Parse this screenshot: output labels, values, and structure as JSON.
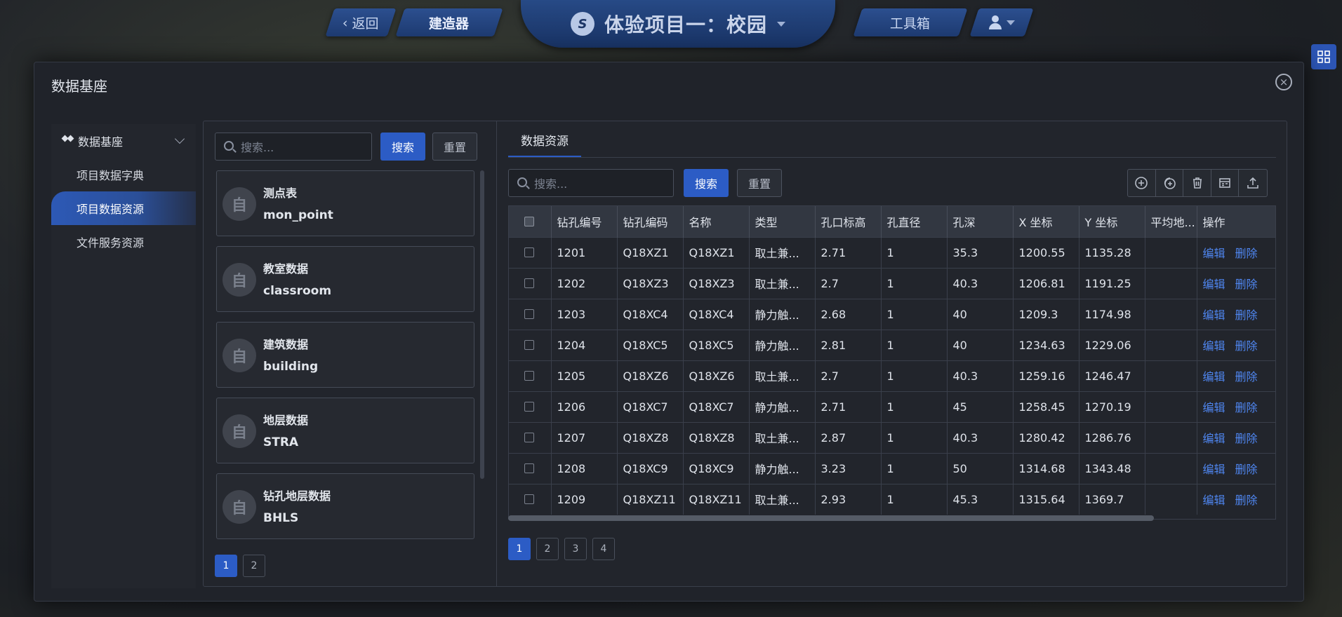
{
  "topnav": {
    "back_label": "返回",
    "builder_label": "建造器",
    "project_title": "体验项目一：校园",
    "logo_text": "S",
    "toolbox_label": "工具箱"
  },
  "modal": {
    "title": "数据基座",
    "close_glyph": "×"
  },
  "leftnav": {
    "group_label": "数据基座",
    "items": [
      {
        "label": "项目数据字典"
      },
      {
        "label": "项目数据资源"
      },
      {
        "label": "文件服务资源"
      }
    ]
  },
  "list_panel": {
    "search_placeholder": "搜索...",
    "search_button": "搜索",
    "reset_button": "重置",
    "avatar_glyph": "自",
    "cards": [
      {
        "name": "测点表",
        "code": "mon_point"
      },
      {
        "name": "教室数据",
        "code": "classroom"
      },
      {
        "name": "建筑数据",
        "code": "building"
      },
      {
        "name": "地层数据",
        "code": "STRA"
      },
      {
        "name": "钻孔地层数据",
        "code": "BHLS"
      }
    ],
    "pages": [
      "1",
      "2"
    ]
  },
  "data_panel": {
    "tab_label": "数据资源",
    "search_placeholder": "搜索...",
    "search_button": "搜索",
    "reset_button": "重置",
    "tools": [
      "add-icon",
      "copy-add-icon",
      "trash-icon",
      "form-icon",
      "upload-icon"
    ],
    "columns": [
      "钻孔编号",
      "钻孔编码",
      "名称",
      "类型",
      "孔口标高",
      "孔直径",
      "孔深",
      "X 坐标",
      "Y 坐标",
      "平均地...",
      "操作"
    ],
    "edit_label": "编辑",
    "delete_label": "删除",
    "rows": [
      [
        "1201",
        "Q18XZ1",
        "Q18XZ1",
        "取土兼...",
        "2.71",
        "1",
        "35.3",
        "1200.55",
        "1135.28",
        ""
      ],
      [
        "1202",
        "Q18XZ3",
        "Q18XZ3",
        "取土兼...",
        "2.7",
        "1",
        "40.3",
        "1206.81",
        "1191.25",
        ""
      ],
      [
        "1203",
        "Q18XC4",
        "Q18XC4",
        "静力触...",
        "2.68",
        "1",
        "40",
        "1209.3",
        "1174.98",
        ""
      ],
      [
        "1204",
        "Q18XC5",
        "Q18XC5",
        "静力触...",
        "2.81",
        "1",
        "40",
        "1234.63",
        "1229.06",
        ""
      ],
      [
        "1205",
        "Q18XZ6",
        "Q18XZ6",
        "取土兼...",
        "2.7",
        "1",
        "40.3",
        "1259.16",
        "1246.47",
        ""
      ],
      [
        "1206",
        "Q18XC7",
        "Q18XC7",
        "静力触...",
        "2.71",
        "1",
        "45",
        "1258.45",
        "1270.19",
        ""
      ],
      [
        "1207",
        "Q18XZ8",
        "Q18XZ8",
        "取土兼...",
        "2.87",
        "1",
        "40.3",
        "1280.42",
        "1286.76",
        ""
      ],
      [
        "1208",
        "Q18XC9",
        "Q18XC9",
        "静力触...",
        "3.23",
        "1",
        "50",
        "1314.68",
        "1343.48",
        ""
      ],
      [
        "1209",
        "Q18XZ11",
        "Q18XZ11",
        "取土兼...",
        "2.93",
        "1",
        "45.3",
        "1315.64",
        "1369.7",
        ""
      ]
    ],
    "pages": [
      "1",
      "2",
      "3",
      "4"
    ]
  },
  "colors": {
    "accent": "#2c5cc5",
    "link": "#4f86f0"
  }
}
